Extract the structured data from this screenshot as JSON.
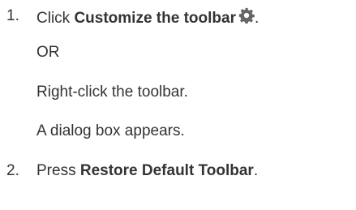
{
  "steps": [
    {
      "number": "1.",
      "prefix": "Click ",
      "bold": "Customize the toolbar",
      "icon": "gear-icon",
      "suffix": "."
    },
    {
      "number": "2.",
      "prefix": "Press ",
      "bold": "Restore Default Toolbar",
      "suffix": "."
    }
  ],
  "alternative": "OR",
  "alternative_action": "Right-click the toolbar.",
  "result": "A dialog box appears.",
  "colors": {
    "text": "#333333",
    "icon": "#666666"
  }
}
